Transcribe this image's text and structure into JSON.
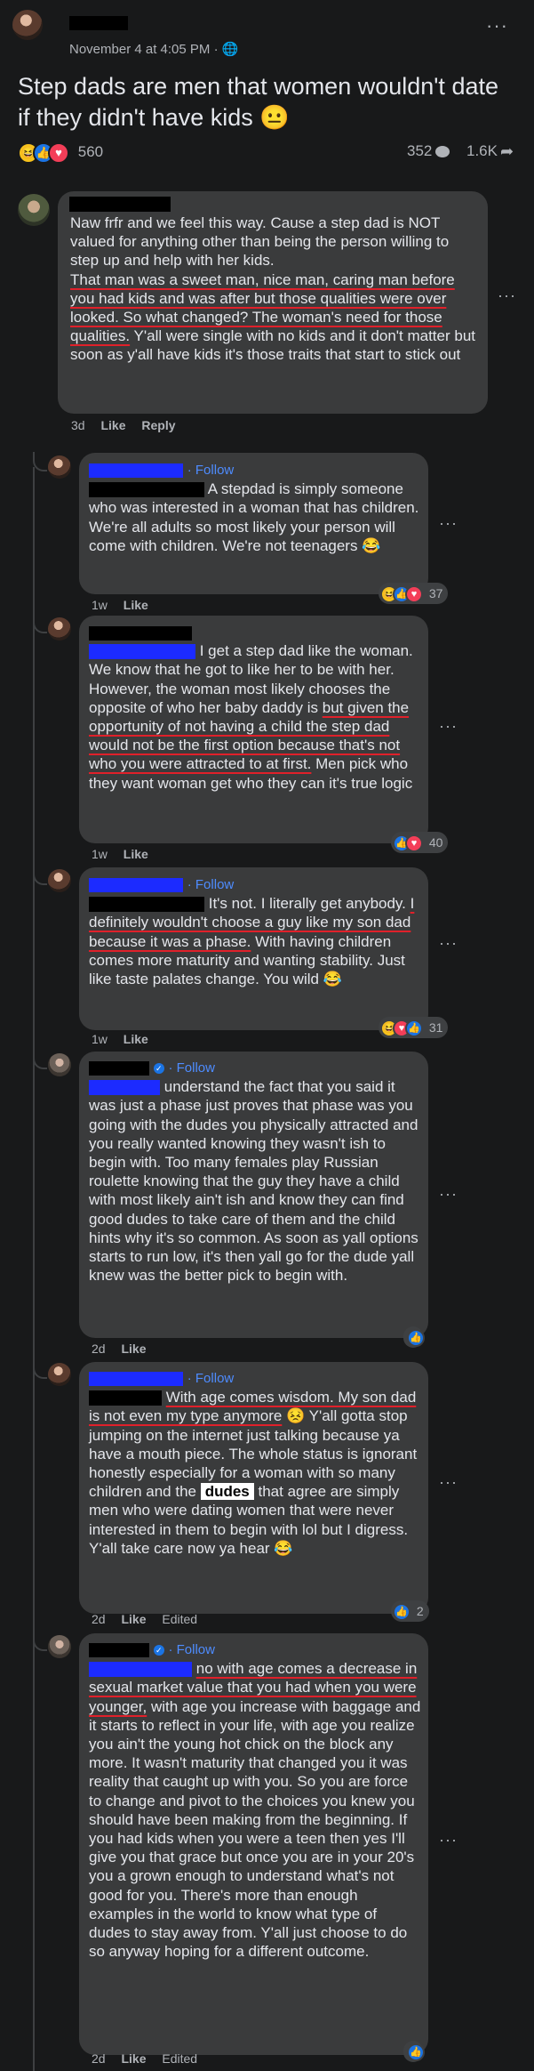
{
  "post": {
    "date": "November 4 at 4:05 PM · ",
    "globe_icon": "globe-icon",
    "more_label": "···",
    "title": "Step dads are men that women wouldn't date if they didn't have kids 😐",
    "reaction_count": "560",
    "comment_count": "352",
    "share_count": "1.6K"
  },
  "comments": [
    {
      "p1": "Naw frfr and we feel this way. Cause a step dad is NOT valued for anything other than being the person willing to step up and help with her kids.",
      "p2": "That man was a sweet man, nice man, caring man before you had kids and was after but those qualities were over looked. So what changed? The woman's need for those qualities.",
      "p3": " Y'all were single with no kids and it don't matter but soon as y'all have kids it's those traits that start to stick out",
      "time": "3d",
      "like": "Like",
      "reply": "Reply"
    },
    {
      "follow": "· Follow",
      "text": "A stepdad is simply someone who was interested in a woman that has children. We're all adults so most likely your person will come with children. We're not teenagers 😂",
      "time": "1w",
      "like": "Like",
      "reactions": "37"
    },
    {
      "p1": "I get a step dad like the woman. We know that he got to like her to be with her. However, the woman most likely chooses the opposite of who her baby daddy is ",
      "p2": "but given the opportunity of not having a child the step dad would not be the first option because that's not who you were attracted to at first.",
      "p3": " Men pick who they want woman get who they can it's true logic",
      "time": "1w",
      "like": "Like",
      "reactions": "40"
    },
    {
      "follow": "· Follow",
      "p1": "It's not. I literally get anybody. ",
      "p2": "I definitely wouldn't choose a guy like my son dad because it was a phase.",
      "p3": " With having children comes more maturity and wanting stability. Just like taste palates change. You wild 😂",
      "time": "1w",
      "like": "Like",
      "reactions": "31"
    },
    {
      "follow": "· Follow",
      "text": "understand the fact that you said it was just a phase just proves that phase was you going with the dudes you physically attracted and you really wanted knowing they wasn't ish to begin with. Too many females play Russian roulette knowing that the guy they have a child with most likely ain't ish and know they can find good dudes to take care of them and the child hints why it's so common. As soon as yall options starts to run low, it's then yall go for the dude yall knew was the better pick to begin with.",
      "time": "2d",
      "like": "Like"
    },
    {
      "follow": "· Follow",
      "p1": "With age comes wisdom. My son dad is not even my type anymore",
      "p2": " 😣 Y'all gotta stop jumping on the internet just talking because ya have a mouth piece. The whole status is ignorant honestly especially for a woman with so many children and the ",
      "dudes": "dudes",
      "p3": " that agree are simply men who were dating women that were never interested in them to begin with lol but I digress. Y'all take care now ya hear 😂",
      "time": "2d",
      "like": "Like",
      "edited": "Edited",
      "reactions": "2"
    },
    {
      "follow": "· Follow",
      "p1": "no with age comes a decrease in sexual market value that you had when you were younger,",
      "p2": " with age you increase with baggage and it starts to reflect in your life, with age you realize you ain't the young hot chick on the block any more. It wasn't maturity that changed you it was reality that caught up with you. So you are force to change and pivot to the choices you knew you should have been making from the beginning. If you had kids when you were a teen then yes I'll give you that grace but once you are in your 20's you a grown enough to understand what's not good for you. There's more than enough examples in the world to know what type of dudes to stay away from. Y'all just choose to do so anyway hoping for a different outcome.",
      "time": "2d",
      "like": "Like",
      "edited": "Edited"
    }
  ],
  "colors": {
    "background": "#18191a",
    "bubble": "#3a3b3c",
    "link": "#4e8cff",
    "underline": "#e0202a",
    "like_blue": "#1b74e4"
  }
}
